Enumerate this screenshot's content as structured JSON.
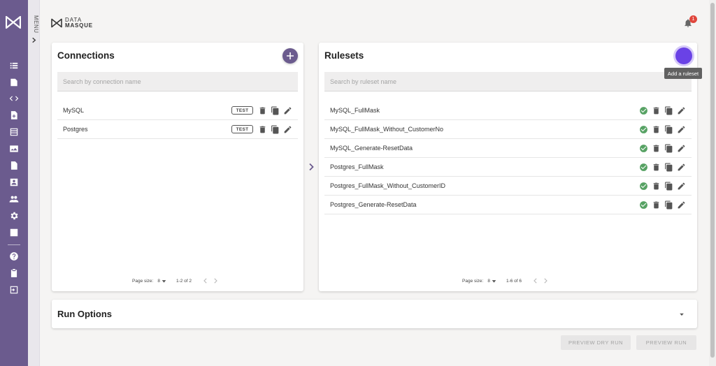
{
  "menu": {
    "label": "MENU"
  },
  "brand": {
    "line1": "DATA",
    "line2": "MASQUE"
  },
  "notifications": {
    "count": "1"
  },
  "connections": {
    "title": "Connections",
    "search_placeholder": "Search by connection name",
    "test_label": "TEST",
    "items": [
      {
        "name": "MySQL"
      },
      {
        "name": "Postgres"
      }
    ],
    "page_size_label": "Page size:",
    "page_size": "8",
    "range": "1-2 of 2"
  },
  "rulesets": {
    "title": "Rulesets",
    "search_placeholder": "Search by ruleset name",
    "add_tooltip": "Add a ruleset",
    "items": [
      {
        "name": "MySQL_FullMask"
      },
      {
        "name": "MySQL_FullMask_Without_CustomerNo"
      },
      {
        "name": "MySQL_Generate-ResetData"
      },
      {
        "name": "Postgres_FullMask"
      },
      {
        "name": "Postgres_FullMask_Without_CustomerID"
      },
      {
        "name": "Postgres_Generate-ResetData"
      }
    ],
    "page_size_label": "Page size:",
    "page_size": "8",
    "range": "1-6 of 6"
  },
  "run_options": {
    "title": "Run Options"
  },
  "actions": {
    "preview_dry_run": "PREVIEW DRY RUN",
    "preview_run": "PREVIEW RUN"
  },
  "colors": {
    "rail": "#6b5b8e",
    "accent": "#6a42e6",
    "valid": "#57a264"
  },
  "icons": {
    "rail": [
      "list-icon",
      "document-icon",
      "code-icon",
      "file-add-icon",
      "table-icon",
      "image-card-icon",
      "file-text-icon",
      "contact-icon",
      "people-icon",
      "gear-icon",
      "checklist-icon",
      "help-icon",
      "clipboard-icon",
      "logout-icon"
    ]
  }
}
